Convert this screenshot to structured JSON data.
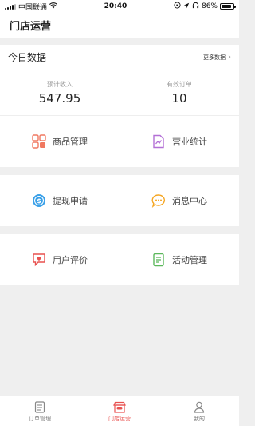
{
  "status_bar": {
    "carrier": "中国联通",
    "time": "20:40",
    "battery": "86%",
    "battery_level": 0.86
  },
  "nav": {
    "title": "门店运营"
  },
  "today": {
    "title": "今日数据",
    "more_label": "更多数据"
  },
  "stats": [
    {
      "label": "预计收入",
      "value": "547.95"
    },
    {
      "label": "有效订单",
      "value": "10"
    }
  ],
  "menu": {
    "products": {
      "label": "商品管理",
      "icon": "product-grid-icon",
      "color": "#f07860"
    },
    "business_stats": {
      "label": "营业统计",
      "icon": "statistics-icon",
      "color": "#b370d6"
    },
    "withdraw": {
      "label": "提现申请",
      "icon": "coin-icon",
      "color": "#3aa0e8"
    },
    "messages": {
      "label": "消息中心",
      "icon": "chat-bubble-icon",
      "color": "#f5a623"
    },
    "reviews": {
      "label": "用户评价",
      "icon": "review-icon",
      "color": "#e8514f"
    },
    "activities": {
      "label": "活动管理",
      "icon": "activity-list-icon",
      "color": "#5cb85c"
    }
  },
  "tabs": [
    {
      "label": "订单管理",
      "icon": "order-icon",
      "active": false
    },
    {
      "label": "门店运营",
      "icon": "store-icon",
      "active": true
    },
    {
      "label": "我的",
      "icon": "user-icon",
      "active": false
    }
  ],
  "colors": {
    "accent": "#e8514f"
  }
}
